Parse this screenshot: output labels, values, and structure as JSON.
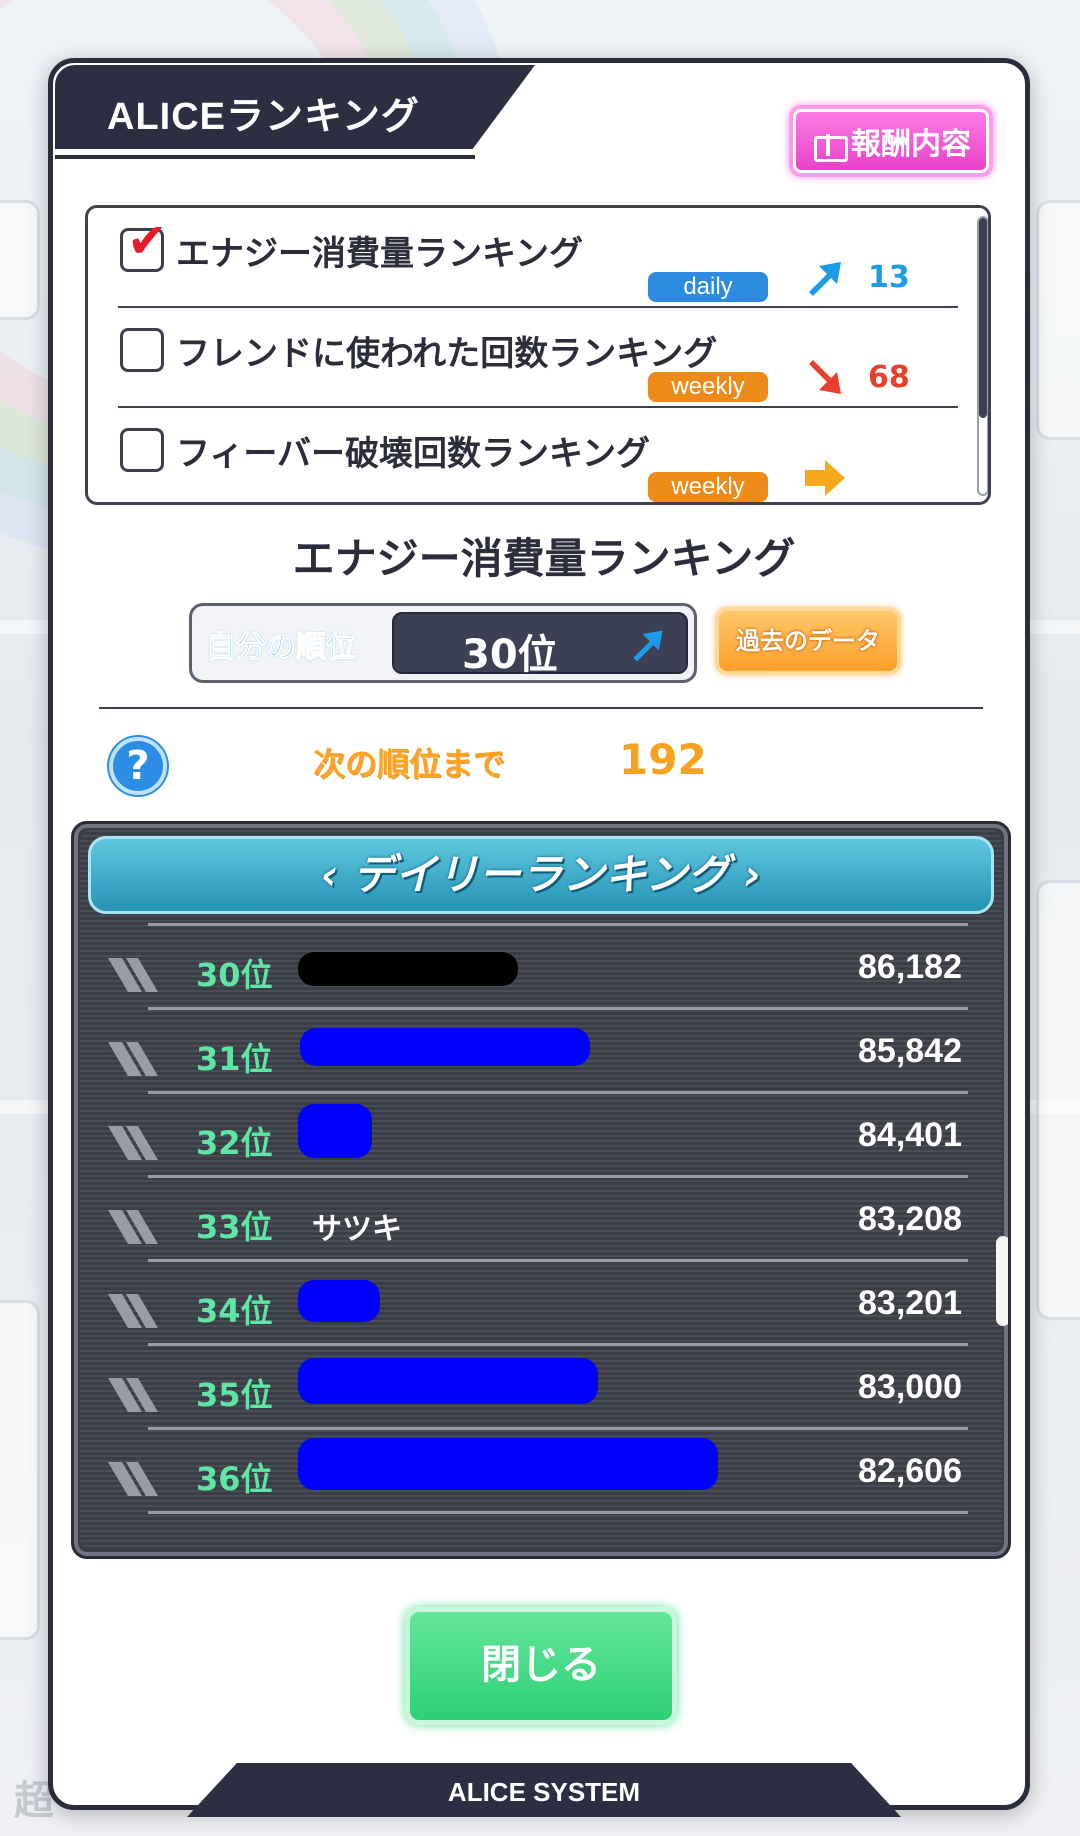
{
  "panel": {
    "title": "ALICEランキング",
    "reward_label": "報酬内容",
    "footer": "ALICE SYSTEM",
    "close_label": "閉じる"
  },
  "ranking_types": [
    {
      "name": "エナジー消費量ランキング",
      "checked": true,
      "period": "daily",
      "trend": "up",
      "change": "13"
    },
    {
      "name": "フレンドに使われた回数ランキング",
      "checked": false,
      "period": "weekly",
      "trend": "down",
      "change": "68"
    },
    {
      "name": "フィーバー破壊回数ランキング",
      "checked": false,
      "period": "weekly",
      "trend": "flat",
      "change": ""
    }
  ],
  "selected": {
    "title": "エナジー消費量ランキング",
    "my_rank_label": "自分の順位",
    "my_rank_value": "30位",
    "past_data_label": "過去のデータ",
    "next_rank_label": "次の順位まで",
    "next_rank_value": "192"
  },
  "leaderboard": {
    "header": "‹ デイリーランキング ›",
    "rows": [
      {
        "rank": "30位",
        "name": "",
        "score": "86,182",
        "redacted": true
      },
      {
        "rank": "31位",
        "name": "",
        "score": "85,842",
        "redacted": true
      },
      {
        "rank": "32位",
        "name": "",
        "score": "84,401",
        "redacted": true
      },
      {
        "rank": "33位",
        "name": "サツキ",
        "score": "83,208",
        "redacted": false
      },
      {
        "rank": "34位",
        "name": "",
        "score": "83,201",
        "redacted": true
      },
      {
        "rank": "35位",
        "name": "",
        "score": "83,000",
        "redacted": true
      },
      {
        "rank": "36位",
        "name": "",
        "score": "82,606",
        "redacted": true
      }
    ]
  },
  "background": {
    "bottom_text": "超"
  },
  "colors": {
    "panel_dark": "#2c2e42",
    "daily_badge": "#2e8ce0",
    "weekly_badge": "#ee8a18",
    "up_arrow": "#1b9be8",
    "down_arrow": "#e8402c",
    "flat_arrow": "#f7a81c",
    "rank_text": "#5fe6a6",
    "redaction_black": "#000000",
    "redaction_blue": "#0000ff"
  },
  "icons": {
    "reward": "gift-icon",
    "help": "question-icon",
    "up": "arrow-up-right-icon",
    "down": "arrow-down-right-icon",
    "flat": "arrow-right-icon"
  }
}
